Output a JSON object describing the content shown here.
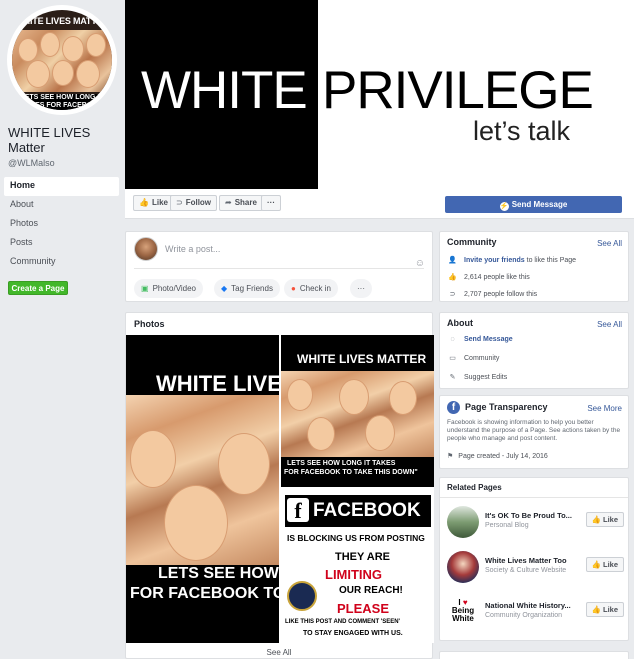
{
  "left": {
    "profile_pic": {
      "top_text": "WHITE LIVES MATTER",
      "bottom_text": "LETS SEE HOW LONG IT TAKES FOR FACEBOOK TO TAKE THIS"
    },
    "page_name": "WHITE LIVES Matter",
    "handle": "@WLMalso",
    "nav": [
      "Home",
      "About",
      "Photos",
      "Posts",
      "Community"
    ],
    "create_page": "Create a Page"
  },
  "cover": {
    "word_white": "WHITE",
    "word_black": "PRIVILEGE",
    "subtitle": "let’s talk"
  },
  "actions": {
    "like": "Like",
    "follow": "Follow",
    "share": "Share",
    "more": "···",
    "send_message": "Send Message"
  },
  "composer": {
    "placeholder": "Write a post...",
    "photo_video": "Photo/Video",
    "tag_friends": "Tag Friends",
    "check_in": "Check in",
    "more": "···"
  },
  "photos": {
    "title": "Photos",
    "see_all": "See All",
    "left": {
      "top": "WHITE LIVES",
      "bottom_1": "LETS SEE HOW LO",
      "bottom_2": "FOR FACEBOOK TO TA"
    },
    "right": {
      "top": "WHITE LIVES MATTER",
      "mid_1": "LETS SEE HOW LONG IT TAKES",
      "mid_2": "FOR FACEBOOK TO TAKE THIS DOWN\"",
      "fb_word": "FACEBOOK",
      "blocking": "IS BLOCKING US FROM POSTING",
      "they_are": "THEY ARE",
      "limiting": "LIMITING",
      "our_reach": "OUR REACH!",
      "please": "PLEASE",
      "like_this": "LIKE THIS POST AND COMMENT 'SEEN'",
      "stay": "TO STAY ENGAGED WITH US."
    }
  },
  "community": {
    "title": "Community",
    "see_all": "See All",
    "invite_link": "Invite your friends",
    "invite_rest": " to like this Page",
    "likes": "2,614 people like this",
    "follows": "2,707 people follow this"
  },
  "about": {
    "title": "About",
    "see_all": "See All",
    "send_message": "Send Message",
    "community": "Community",
    "suggest_edits": "Suggest Edits"
  },
  "transparency": {
    "title": "Page Transparency",
    "see_more": "See More",
    "description": "Facebook is showing information to help you better understand the purpose of a Page. See actions taken by the people who manage and post content.",
    "created": "Page created - July 14, 2016"
  },
  "related": {
    "title": "Related Pages",
    "like_label": "Like",
    "items": [
      {
        "name": "It's OK To Be Proud To...",
        "category": "Personal Blog"
      },
      {
        "name": "White Lives Matter Too",
        "category": "Society & Culture Website"
      },
      {
        "name": "National White History...",
        "category": "Community Organization",
        "thumb_1": "I",
        "thumb_2": "Being",
        "thumb_3": "White"
      }
    ]
  },
  "colors": {
    "facebook_blue": "#4267b2",
    "link_blue": "#365899",
    "green": "#42b72a",
    "background": "#e9ebee"
  }
}
